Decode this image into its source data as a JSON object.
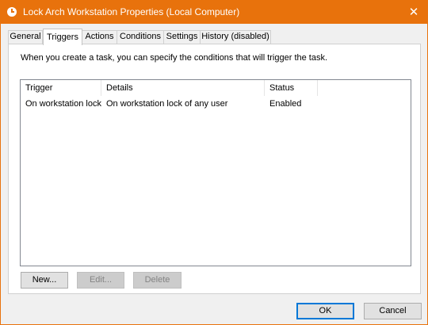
{
  "window": {
    "title": "Lock Arch Workstation Properties (Local Computer)",
    "close_glyph": "✕",
    "accent_color": "#e8720c"
  },
  "tabs": [
    {
      "label": "General"
    },
    {
      "label": "Triggers"
    },
    {
      "label": "Actions"
    },
    {
      "label": "Conditions"
    },
    {
      "label": "Settings"
    },
    {
      "label": "History (disabled)"
    }
  ],
  "triggers_tab": {
    "description": "When you create a task, you can specify the conditions that will trigger the task.",
    "columns": [
      "Trigger",
      "Details",
      "Status"
    ],
    "rows": [
      {
        "trigger": "On workstation lock",
        "details": "On workstation lock of any user",
        "status": "Enabled"
      }
    ],
    "buttons": {
      "new": "New...",
      "edit": "Edit...",
      "delete": "Delete"
    }
  },
  "dialog_buttons": {
    "ok": "OK",
    "cancel": "Cancel"
  }
}
